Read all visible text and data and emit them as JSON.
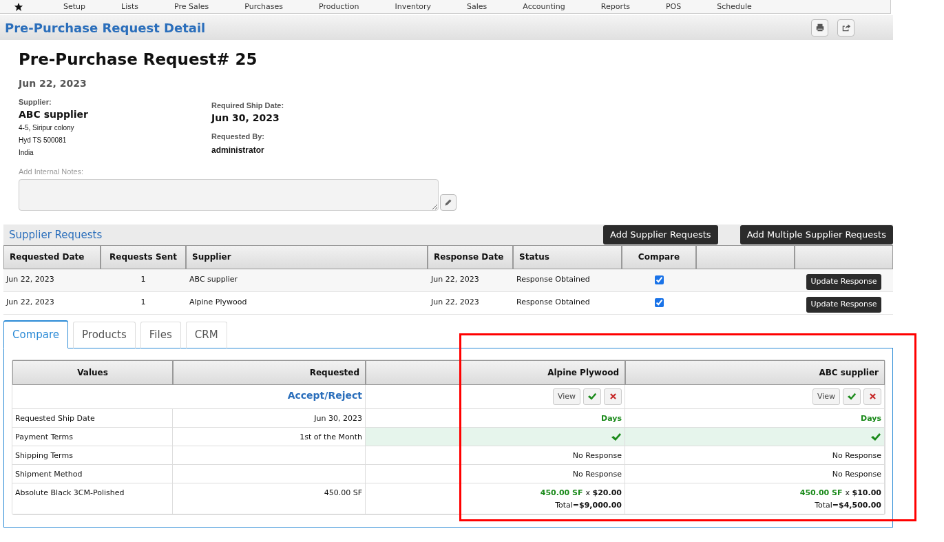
{
  "nav": {
    "items": [
      "Setup",
      "Lists",
      "Pre Sales",
      "Purchases",
      "Production",
      "Inventory",
      "Sales",
      "Accounting",
      "Reports",
      "POS",
      "Schedule"
    ]
  },
  "page_header": {
    "title": "Pre-Purchase Request Detail"
  },
  "request": {
    "title": "Pre-Purchase Request# 25",
    "date": "Jun 22, 2023",
    "supplier_label": "Supplier:",
    "supplier_name": "ABC supplier",
    "address": [
      "4-5, Siripur colony",
      "Hyd TS 500081",
      "India"
    ],
    "ship_date_label": "Required Ship Date:",
    "ship_date": "Jun 30, 2023",
    "requested_by_label": "Requested By:",
    "requested_by": "administrator",
    "notes_label": "Add Internal Notes:"
  },
  "supplier_requests": {
    "title": "Supplier Requests",
    "buttons": [
      "Add Supplier Requests",
      "Add Multiple Supplier Requests"
    ],
    "columns": [
      "Requested Date",
      "Requests Sent",
      "Supplier",
      "Response Date",
      "Status",
      "Compare"
    ],
    "rows": [
      {
        "requested_date": "Jun 22, 2023",
        "sent": "1",
        "supplier": "ABC supplier",
        "response_date": "Jun 22, 2023",
        "status": "Response Obtained",
        "compare": true,
        "action": "Update Response"
      },
      {
        "requested_date": "Jun 22, 2023",
        "sent": "1",
        "supplier": "Alpine Plywood",
        "response_date": "Jun 22, 2023",
        "status": "Response Obtained",
        "compare": true,
        "action": "Update Response"
      }
    ]
  },
  "tabs": [
    {
      "label": "Compare",
      "selected": true
    },
    {
      "label": "Products",
      "selected": false
    },
    {
      "label": "Files",
      "selected": false
    },
    {
      "label": "CRM",
      "selected": false
    }
  ],
  "compare": {
    "columns": [
      "Values",
      "Requested"
    ],
    "action_label": "Accept/Reject",
    "suppliers": [
      {
        "name": "Alpine Plywood",
        "view": "View"
      },
      {
        "name": "ABC supplier",
        "view": "View"
      }
    ],
    "rows": [
      {
        "label": "Requested Ship Date",
        "requested": "Jun 30, 2023",
        "matched": false,
        "cells": [
          {
            "kind": "accent",
            "text": "Days"
          },
          {
            "kind": "accent",
            "text": "Days"
          }
        ]
      },
      {
        "label": "Payment Terms",
        "requested": "1st of the Month",
        "matched": true,
        "cells": [
          {
            "kind": "check"
          },
          {
            "kind": "check"
          }
        ]
      },
      {
        "label": "Shipping Terms",
        "matched": false,
        "cells": [
          {
            "kind": "plain",
            "text": "No Response"
          },
          {
            "kind": "plain",
            "text": "No Response"
          }
        ]
      },
      {
        "label": "Shipment Method",
        "matched": false,
        "cells": [
          {
            "kind": "plain",
            "text": "No Response"
          },
          {
            "kind": "plain",
            "text": "No Response"
          }
        ]
      },
      {
        "label": "Absolute Black 3CM-Polished",
        "requested": "450.00 SF",
        "matched": false,
        "cells": [
          {
            "kind": "price",
            "qty": "450.00 SF",
            "price": "x **$20.00**",
            "total": "Total=**$9,000.00**"
          },
          {
            "kind": "price",
            "qty": "450.00 SF",
            "price": "x **$10.00**",
            "total": "Total=**$4,500.00**"
          }
        ]
      }
    ]
  }
}
